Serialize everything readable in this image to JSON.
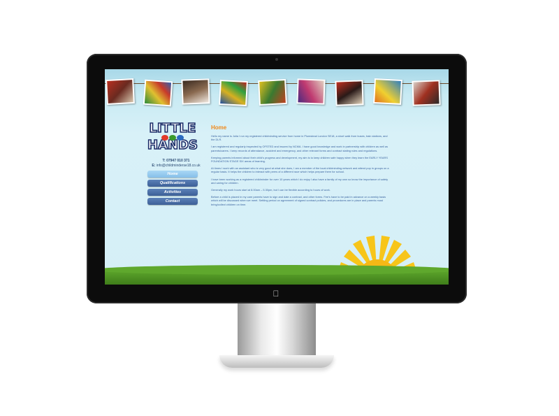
{
  "site": {
    "logo_line1": "LITTLE",
    "logo_line2": "HANDS",
    "telephone": "T: 07947 010 371",
    "email_prefix": "E:",
    "email": "info@childminderse18.co.uk"
  },
  "nav": {
    "items": [
      {
        "label": "Home",
        "active": true
      },
      {
        "label": "Qualifications",
        "active": false
      },
      {
        "label": "Activities",
        "active": false
      },
      {
        "label": "Contact",
        "active": false
      }
    ]
  },
  "content": {
    "title": "Home",
    "p1": "Hello my name is Julia I run my registered childminding service from home in Plumstead London SE18, a short walk from buses, train stations, and the DLR.",
    "p2": "I am registered and regularly inspected by OFSTED and insured by NCMA. I have good knowledge and work in partnership with children as well as parents/carers. I keep records of attendance, accident and emergency, and other relevant forms and contract stating rules and regulations.",
    "p3": "Keeping parents informed about their child's progress and development, my aim is to keep children safe happy when they learn the EARLY YEARS FOUNDATION STAGE SIX areas of learning.",
    "p4": "At times I work with an assistant who is very good at what she does, I am a member of the local childminding network and attend pop in groups on a regular basis. It helps the children to interact with peers of a different race which helps prepare them for school.",
    "p5": "I have been working as a registered childminder for over 10 years which I do enjoy I also have a family of my own so know the importance of safety and caring for children.",
    "p6": "Generally my work hours start at 8.00am – 5.30pm, but I can be flexible according to hours of work.",
    "p7": "Before a child is placed in my care parents have to sign and date a contract, and other forms. Fee's have to be paid in advance on a weekly basis which will be discussed when we meet. Settling period on agreement of signed contract policies, and procedures are in place and parents must bring/collect children on time."
  },
  "colors": {
    "title": "#f08a1c",
    "text": "#3a63a0",
    "nav_button": "#4a6fa8",
    "nav_active": "#96c9ef",
    "grass": "#4f9524",
    "sun": "#f7c51a"
  }
}
